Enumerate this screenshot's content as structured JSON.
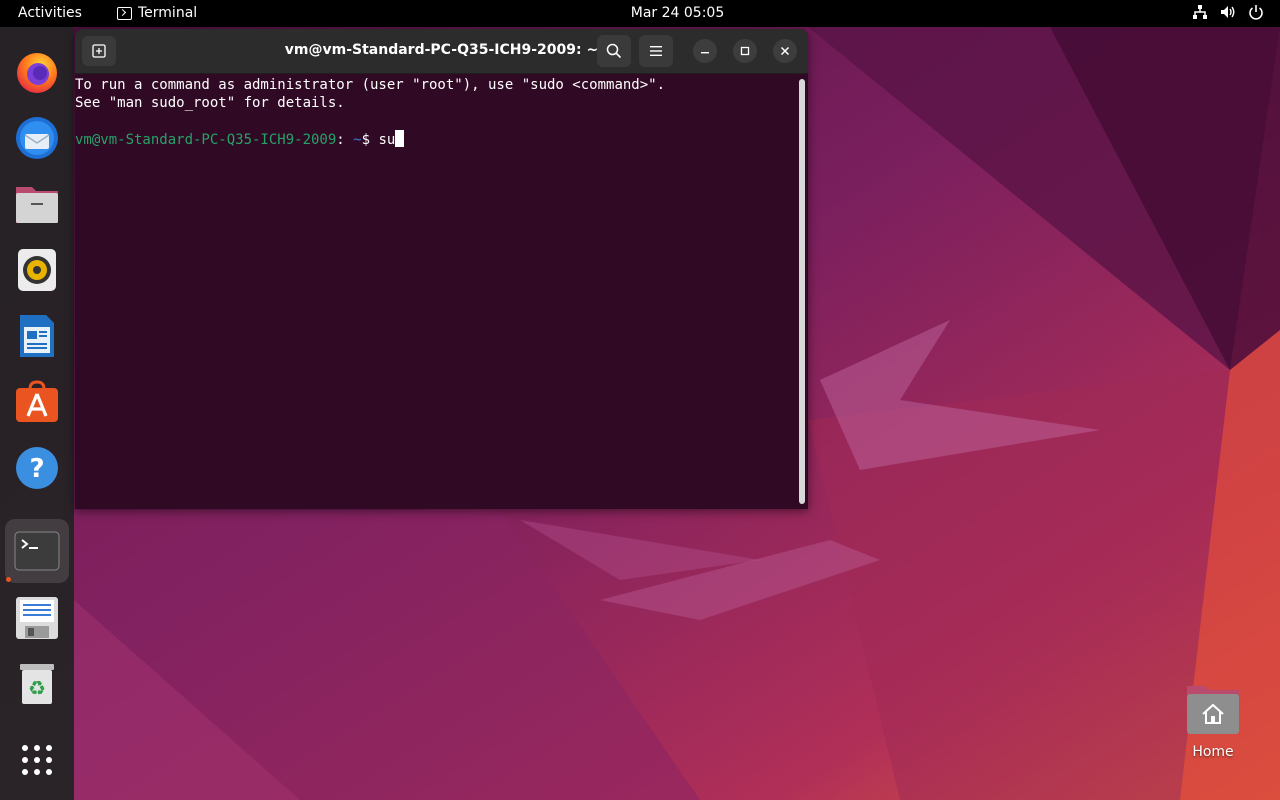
{
  "topbar": {
    "activities": "Activities",
    "app_name": "Terminal",
    "app_icon": "terminal-icon",
    "clock": "Mar 24  05:05",
    "tray_icons": [
      "network-icon",
      "volume-icon",
      "power-icon"
    ]
  },
  "dock": {
    "items": [
      {
        "name": "firefox",
        "icon": "firefox-icon"
      },
      {
        "name": "thunderbird",
        "icon": "thunderbird-icon"
      },
      {
        "name": "files",
        "icon": "files-icon"
      },
      {
        "name": "rhythmbox",
        "icon": "rhythmbox-icon"
      },
      {
        "name": "libreoffice-writer",
        "icon": "writer-icon"
      },
      {
        "name": "app-center",
        "icon": "software-icon"
      },
      {
        "name": "help",
        "icon": "help-icon"
      },
      {
        "name": "terminal",
        "icon": "terminal-icon",
        "active": true
      },
      {
        "name": "text-editor",
        "icon": "floppy-icon"
      },
      {
        "name": "trash",
        "icon": "trash-icon"
      },
      {
        "name": "show-apps",
        "icon": "app-grid-icon"
      }
    ]
  },
  "terminal": {
    "title": "vm@vm-Standard-PC-Q35-ICH9-2009: ~",
    "lines": [
      "To run a command as administrator (user \"root\"), use \"sudo <command>\".",
      "See \"man sudo_root\" for details."
    ],
    "prompt_user": "vm@vm-Standard-PC-Q35-ICH9-2009",
    "prompt_sep": ":",
    "prompt_path": " ~",
    "prompt_symbol": "$ ",
    "input": "su"
  },
  "desktop": {
    "home_label": "Home"
  },
  "colors": {
    "terminal_bg": "#300a24",
    "prompt_green": "#26a269",
    "accent": "#e95420"
  }
}
